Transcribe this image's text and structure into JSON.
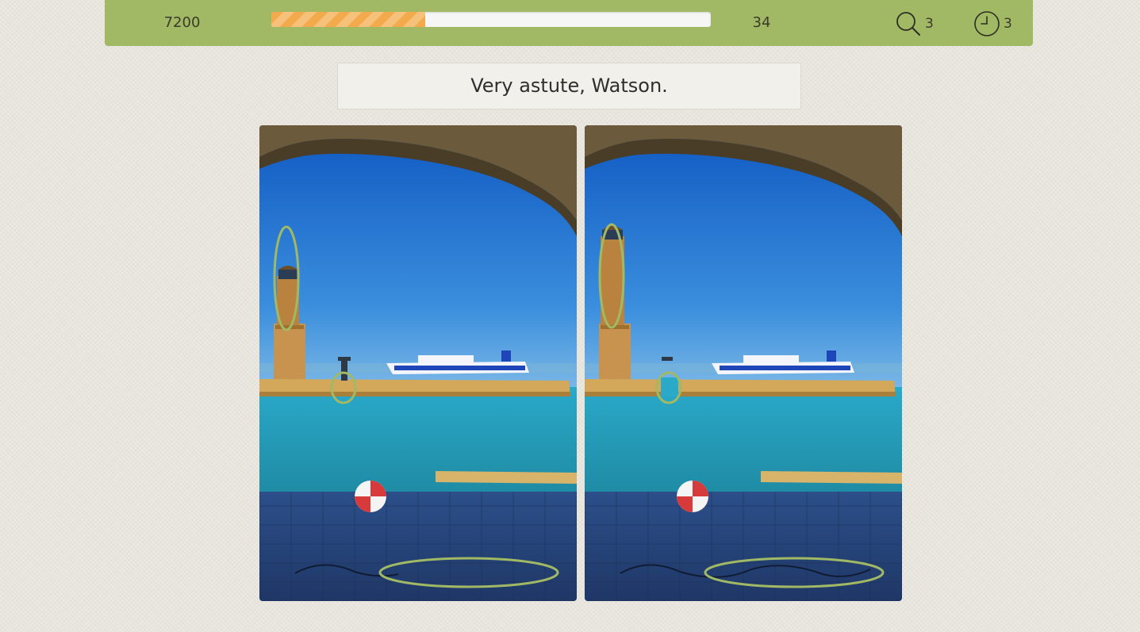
{
  "header": {
    "score": "7200",
    "progress_fraction": 0.35,
    "timer": "34",
    "hints": {
      "icon": "magnifier-icon",
      "count": "3"
    },
    "time_bonus": {
      "icon": "clock-icon",
      "count": "3"
    }
  },
  "message": {
    "text": "Very astute, Watson."
  },
  "scene": {
    "left_image": "harbor-lighthouse-original",
    "right_image": "harbor-lighthouse-altered",
    "found_differences": 3
  },
  "colors": {
    "topbar": "#a1b964",
    "marker": "#a1b964",
    "progress_fill": "#f2aa4c"
  }
}
